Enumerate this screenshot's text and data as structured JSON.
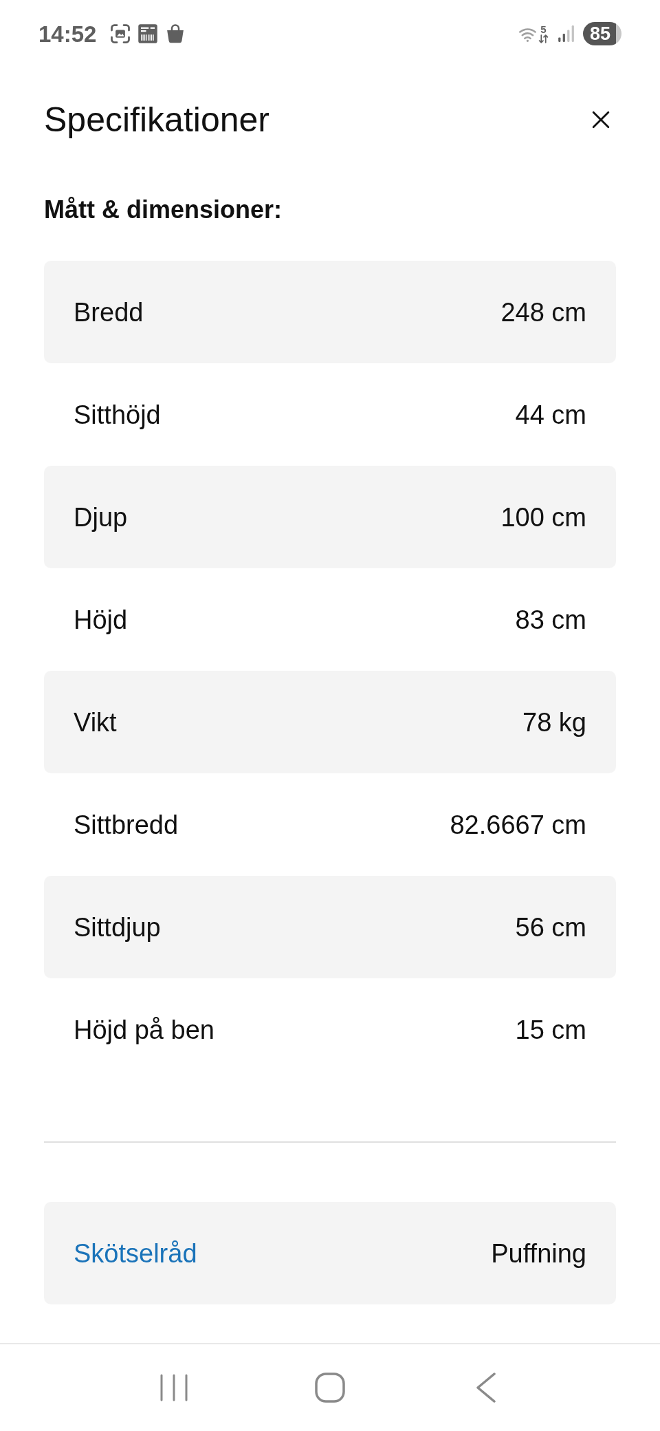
{
  "status_bar": {
    "time": "14:52",
    "network_type": "5",
    "battery": "85"
  },
  "header": {
    "title": "Specifikationer"
  },
  "dimensions": {
    "heading": "Mått & dimensioner:",
    "rows": [
      {
        "label": "Bredd",
        "value": "248 cm"
      },
      {
        "label": "Sitthöjd",
        "value": "44 cm"
      },
      {
        "label": "Djup",
        "value": "100 cm"
      },
      {
        "label": "Höjd",
        "value": "83 cm"
      },
      {
        "label": "Vikt",
        "value": "78 kg"
      },
      {
        "label": "Sittbredd",
        "value": "82.6667 cm"
      },
      {
        "label": "Sittdjup",
        "value": "56 cm"
      },
      {
        "label": "Höjd på ben",
        "value": "15 cm"
      }
    ]
  },
  "care": {
    "label": "Skötselråd",
    "value": "Puffning"
  }
}
